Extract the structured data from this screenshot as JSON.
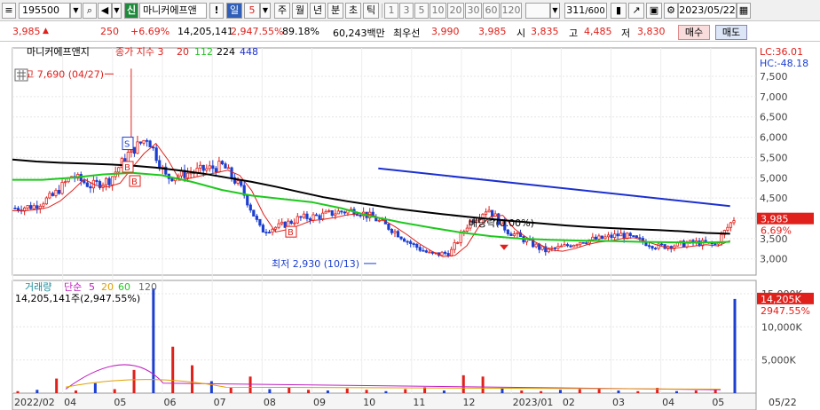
{
  "toolbar": {
    "code": "195500",
    "credit_badge": "신",
    "stock_name": "마니커에프앤",
    "warn_icon_text": "!",
    "period_day": "일",
    "period_count": "5",
    "periods": [
      "주",
      "월",
      "년",
      "분",
      "초",
      "틱"
    ],
    "intervals": [
      "1",
      "3",
      "5",
      "10",
      "20",
      "30",
      "60",
      "120"
    ],
    "bar_count": "311",
    "bar_total": "/600",
    "date": "2023/05/22"
  },
  "quote": {
    "price": "3,985",
    "change": "250",
    "change_pct": "+6.69%",
    "volume": "14,205,141",
    "volume_pct": "2,947.55%",
    "rate": "89.18%",
    "amount": "60,243백만",
    "pref_label": "최우선",
    "best_ask": "3,990",
    "best_bid": "3,985",
    "open_label": "시",
    "open": "3,835",
    "high_label": "고",
    "high": "4,485",
    "low_label": "저",
    "low": "3,830",
    "buy_label": "매수",
    "sell_label": "매도"
  },
  "price_panel": {
    "legend_name": "마니커에프앤지",
    "legend_main": "종가 지수 3",
    "ma_labels": [
      "20",
      "112",
      "224",
      "448"
    ],
    "ma_colors": [
      "#e0201b",
      "#1ec81e",
      "#000000",
      "#1c30d0"
    ],
    "high_note": "최고 7,690 (04/27)",
    "low_note": "최저 2,930 (10/13)",
    "dividend_note": "배당락(0.00%)",
    "lc_label": "LC:36.01",
    "hc_label": "HC:-48.18",
    "price_tag": "3,985",
    "pct_tag": "6.69%",
    "signal_b": "B",
    "signal_s": "S"
  },
  "volume_panel": {
    "legend_name": "거래량",
    "legend_simple": "단순",
    "ma_labels": [
      "5",
      "20",
      "60",
      "120"
    ],
    "ma_colors": [
      "#c020c0",
      "#e0a000",
      "#1ec81e",
      "#6a6a6a"
    ],
    "summary": "14,205,141주(2,947.55%)",
    "vol_tag": "14,205K",
    "pct_tag": "2947.55%"
  },
  "chart_data": [
    {
      "type": "candlestick",
      "title": "마니커에프앤지",
      "ylim": [
        2600,
        8200
      ],
      "y_ticks": [
        3000,
        3500,
        4000,
        4500,
        5000,
        5500,
        6000,
        6500,
        7000,
        7500
      ],
      "y_tick_labels": [
        "3,000",
        "3,500",
        "4,000",
        "4,500",
        "5,000",
        "5,500",
        "6,000",
        "6,500",
        "7,000",
        "7,500"
      ],
      "x_tick_labels": [
        "2022/02",
        "04",
        "05",
        "06",
        "07",
        "08",
        "09",
        "10",
        "11",
        "12",
        "2023/01",
        "02",
        "03",
        "04",
        "05",
        "05/22"
      ],
      "close_series": [
        4250,
        4300,
        4550,
        5050,
        4800,
        4950,
        5600,
        6000,
        5000,
        5100,
        5200,
        5300,
        4700,
        3700,
        3800,
        4000,
        4050,
        4150,
        4200,
        4000,
        3700,
        3350,
        3100,
        3150,
        3900,
        4250,
        3700,
        3450,
        3200,
        3300,
        3450,
        3500,
        3600,
        3450,
        3300,
        3350,
        3400,
        3350,
        3985
      ],
      "high": 7690,
      "low": 2930,
      "last": 3985,
      "ma112": [
        4950,
        4950,
        5000,
        5080,
        5120,
        5060,
        4900,
        4700,
        4560,
        4480,
        4400,
        4250,
        4050,
        3900,
        3770,
        3650,
        3560,
        3500,
        3470,
        3450,
        3440,
        3420,
        3410,
        3400,
        3420
      ],
      "ma224": [
        5450,
        5400,
        5370,
        5350,
        5330,
        5300,
        5250,
        5180,
        5100,
        5000,
        4900,
        4780,
        4650,
        4520,
        4420,
        4330,
        4240,
        4170,
        4100,
        4040,
        3980,
        3930,
        3880,
        3830,
        3790,
        3760,
        3730,
        3710,
        3680,
        3640,
        3620
      ],
      "ma448": [
        5230,
        4300
      ]
    },
    {
      "type": "bar",
      "title": "거래량",
      "ylim": [
        0,
        17000
      ],
      "y_ticks": [
        5000,
        10000,
        15000
      ],
      "y_tick_labels": [
        "5,000K",
        "10,000K",
        "15,000K"
      ],
      "volumes_k": [
        300,
        500,
        2200,
        400,
        1500,
        600,
        3500,
        15800,
        7000,
        4200,
        1800,
        800,
        2500,
        600,
        900,
        500,
        400,
        700,
        500,
        300,
        600,
        900,
        400,
        2700,
        2500,
        800,
        400,
        300,
        500,
        600,
        700,
        400,
        300,
        800,
        300,
        400,
        600,
        14205
      ],
      "last_k": 14205
    }
  ]
}
